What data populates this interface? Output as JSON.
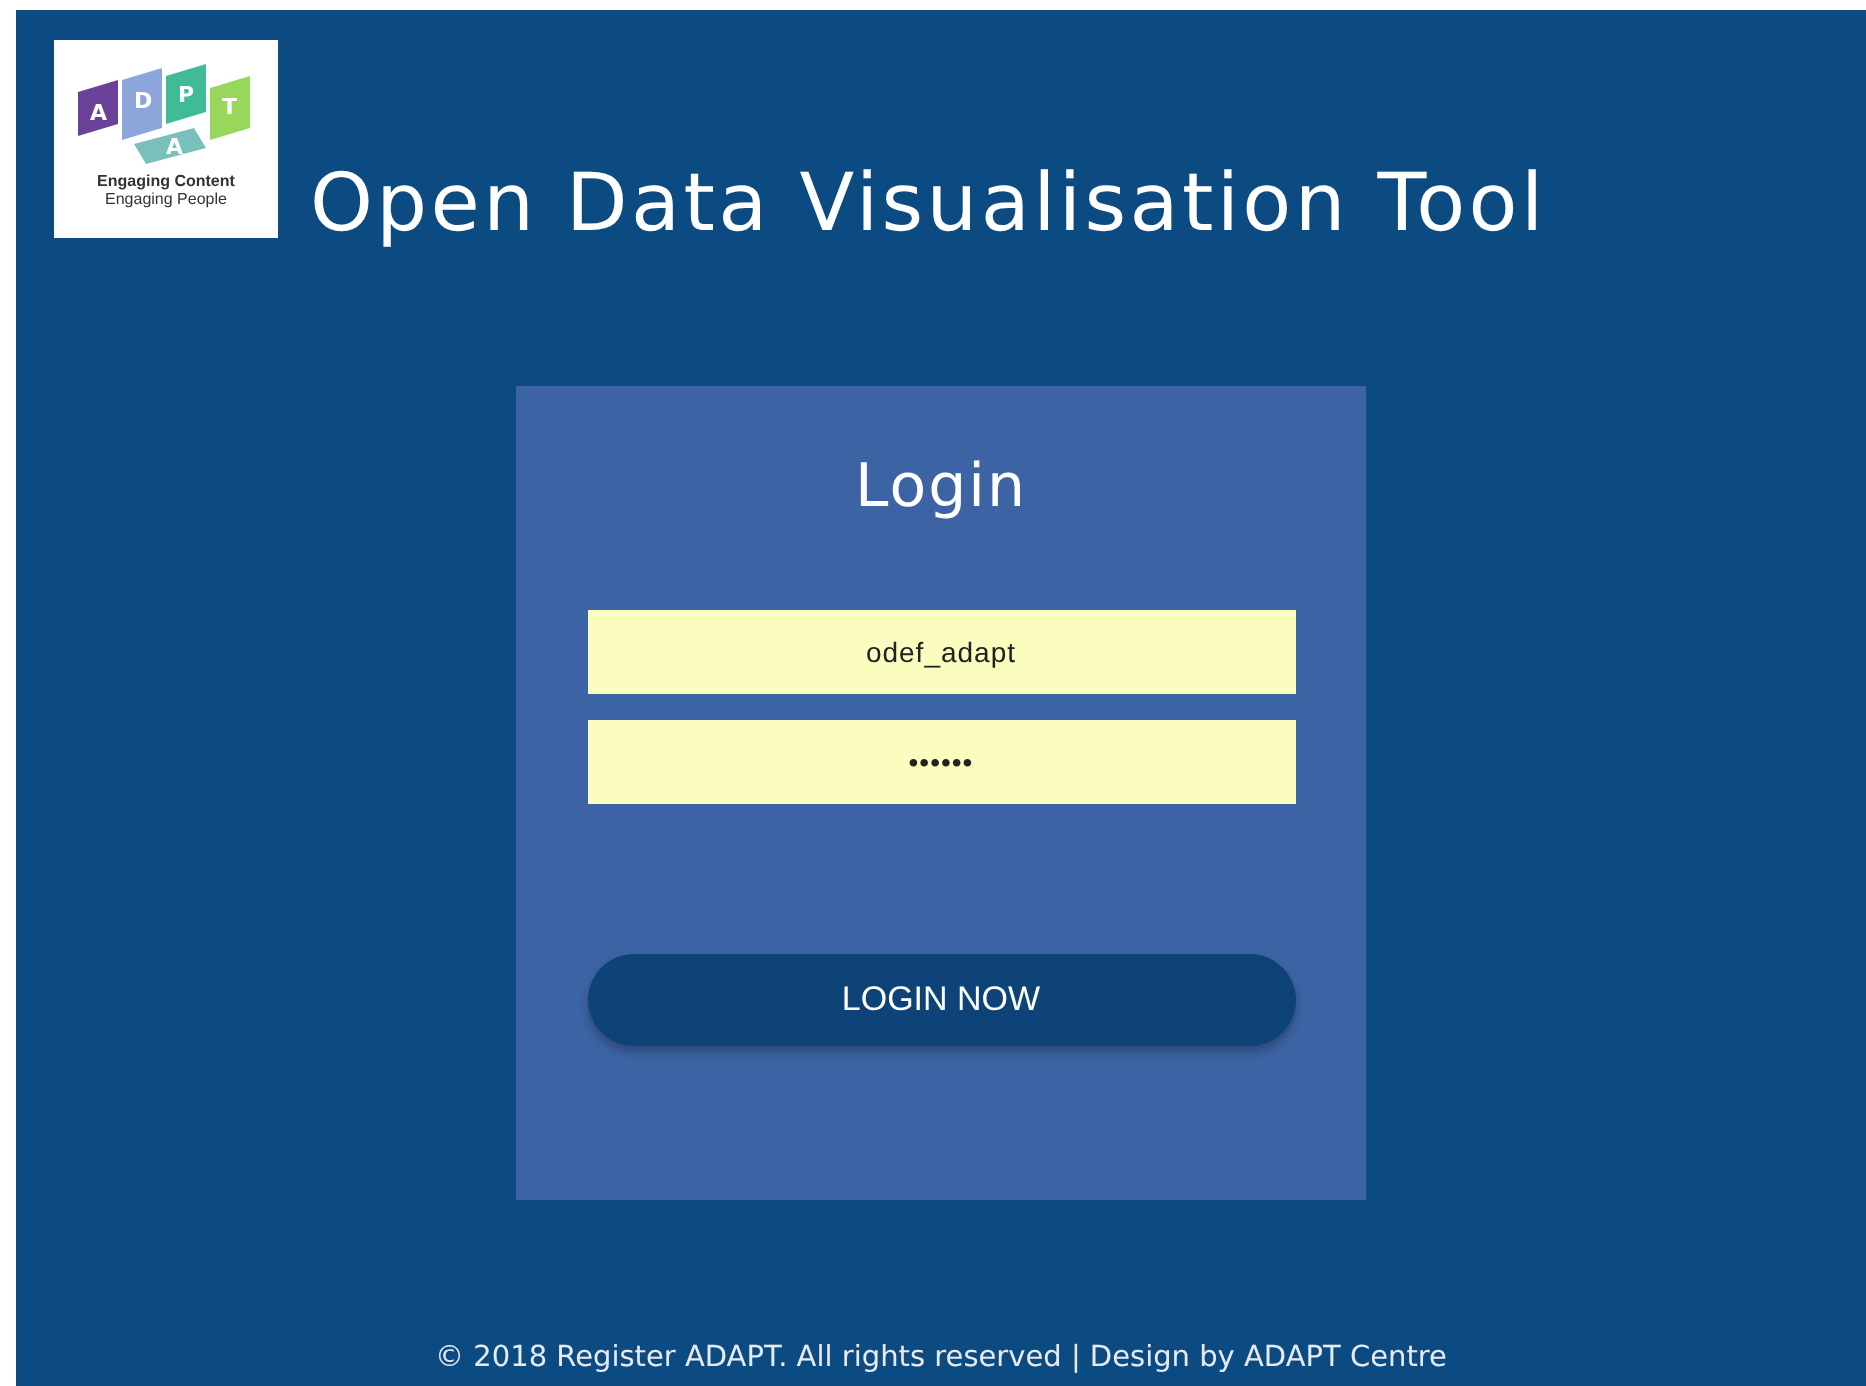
{
  "logo": {
    "letters": [
      "A",
      "D",
      "P",
      "A",
      "T"
    ],
    "tagline": [
      "Engaging Content",
      "Engaging People"
    ]
  },
  "title": "Open Data Visualisation Tool",
  "login": {
    "heading": "Login",
    "fields": [
      {
        "value": "odef_adapt"
      },
      {
        "value": "••••••"
      }
    ],
    "button": "LOGIN NOW"
  },
  "footer": "© 2018 Register ADAPT. All rights reserved | Design by ADAPT Centre"
}
